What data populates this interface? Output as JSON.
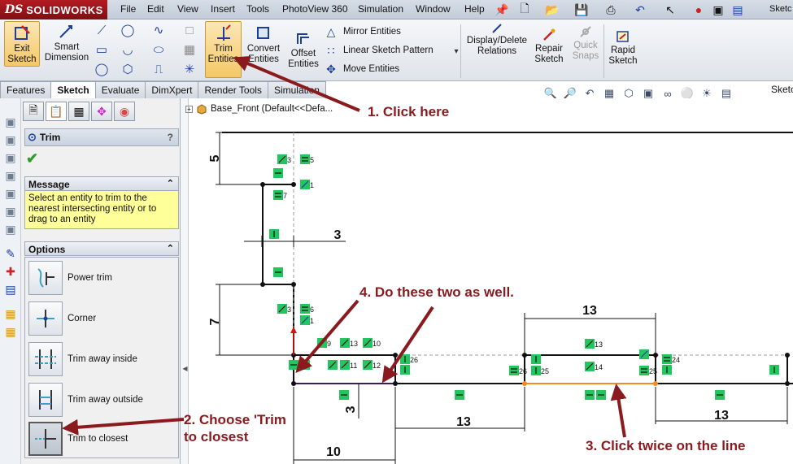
{
  "app": {
    "brand_prefix": "DS",
    "brand_name": "SOLIDWORKS",
    "corner_text": "Sketc"
  },
  "menu": [
    "File",
    "Edit",
    "View",
    "Insert",
    "Tools",
    "PhotoView 360",
    "Simulation",
    "Window",
    "Help"
  ],
  "ribbon": {
    "exit_sketch": "Exit Sketch",
    "smart_dimension": "Smart Dimension",
    "trim_entities": "Trim Entities",
    "convert_entities": "Convert Entities",
    "offset_entities": "Offset Entities",
    "mirror_entities": "Mirror Entities",
    "linear_sketch_pattern": "Linear Sketch Pattern",
    "move_entities": "Move Entities",
    "display_delete_relations": "Display/Delete Relations",
    "repair_sketch": "Repair Sketch",
    "quick_snaps": "Quick Snaps",
    "rapid_sketch": "Rapid Sketch"
  },
  "tabs": [
    "Features",
    "Sketch",
    "Evaluate",
    "DimXpert",
    "Render Tools",
    "Simulation"
  ],
  "active_tab": "Sketch",
  "property_manager": {
    "title": "Trim",
    "help": "?",
    "message_header": "Message",
    "message": "Select an entity to trim to the nearest intersecting entity or to drag to an entity",
    "options_header": "Options",
    "options": [
      "Power trim",
      "Corner",
      "Trim away inside",
      "Trim away outside",
      "Trim to closest"
    ],
    "selected_option": "Trim to closest"
  },
  "feature_tree": {
    "node": "Base_Front  (Default<<Defa..."
  },
  "dimensions": [
    "5",
    "3",
    "7",
    "13",
    "3",
    "13",
    "13",
    "10"
  ],
  "relation_tags": [
    "3",
    "5",
    "1",
    "7",
    "3",
    "6",
    "1",
    "9",
    "13",
    "10",
    "11",
    "12",
    "26",
    "26",
    "25",
    "13",
    "14",
    "25",
    "24"
  ],
  "callouts": {
    "c1": "1. Click here",
    "c2": "2. Choose 'Trim\nto closest",
    "c3": "3. Click twice on the line",
    "c4": "4. Do these two as well."
  },
  "colors": {
    "callout": "#8b1a1f",
    "relation_green": "#22c55e",
    "highlight_line": "#f28c1f",
    "trim_pressed": "#f4c867"
  }
}
